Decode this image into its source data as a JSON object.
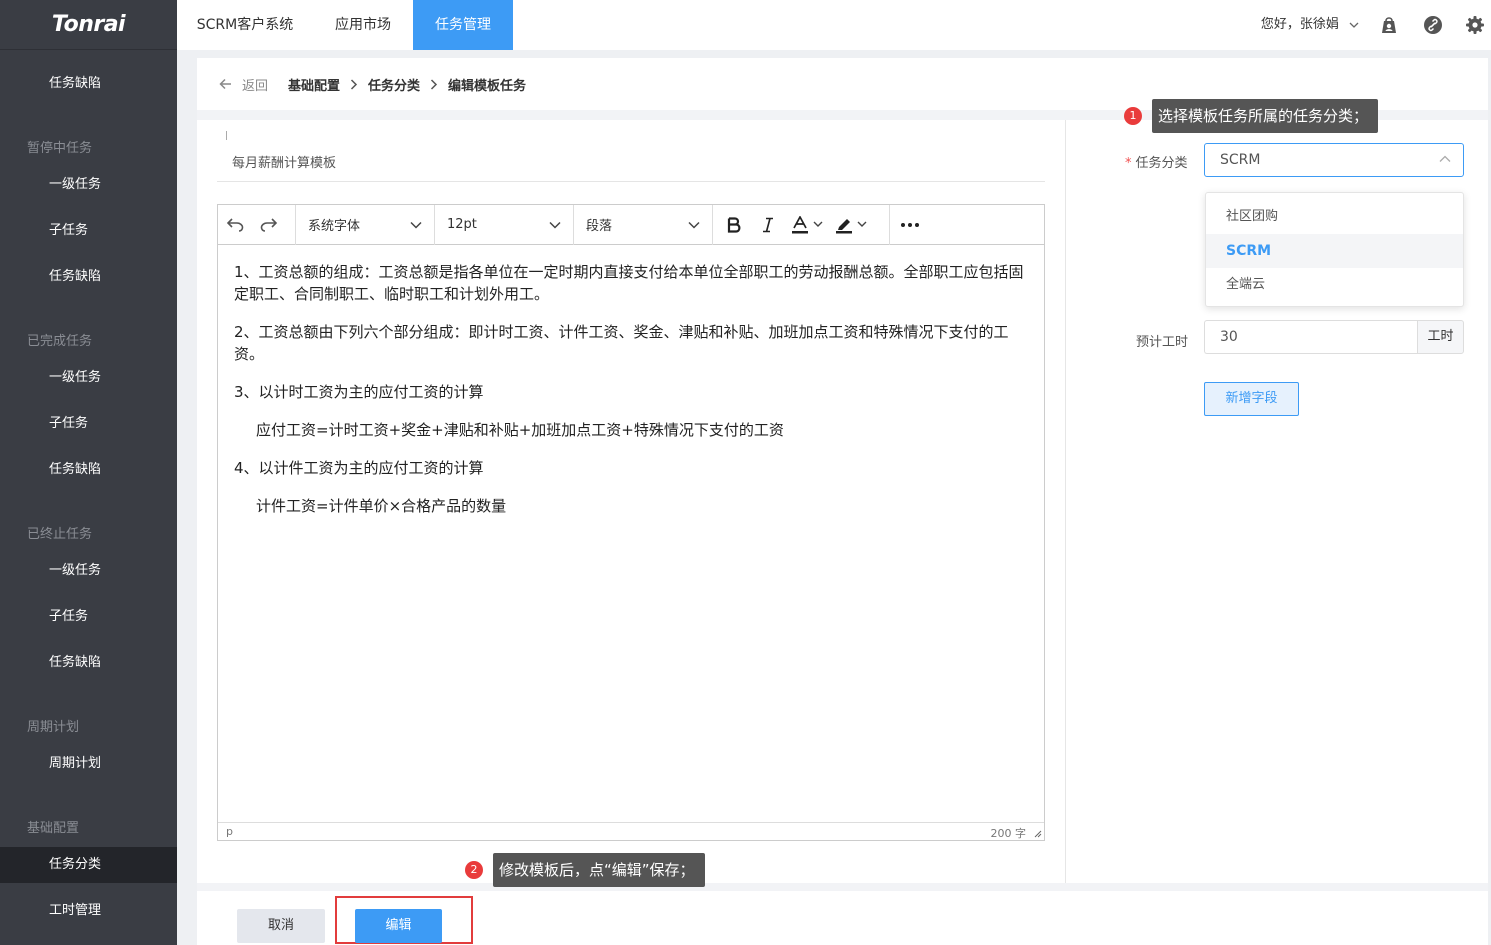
{
  "app": {
    "logo": "Tonrai"
  },
  "sidebar": {
    "groups": [
      {
        "title": "",
        "items": [
          "任务缺陷"
        ]
      },
      {
        "title": "暂停中任务",
        "items": [
          "一级任务",
          "子任务",
          "任务缺陷"
        ]
      },
      {
        "title": "已完成任务",
        "items": [
          "一级任务",
          "子任务",
          "任务缺陷"
        ]
      },
      {
        "title": "已终止任务",
        "items": [
          "一级任务",
          "子任务",
          "任务缺陷"
        ]
      },
      {
        "title": "周期计划",
        "items": [
          "周期计划"
        ]
      },
      {
        "title": "基础配置",
        "items": [
          "任务分类",
          "工时管理"
        ]
      }
    ],
    "active_item": "任务分类"
  },
  "topbar": {
    "nav": [
      "SCRM客户系统",
      "应用市场",
      "任务管理"
    ],
    "active_nav": "任务管理",
    "greeting": "您好，张徐娟",
    "icons": [
      "user-bag-icon",
      "link-icon",
      "gear-icon"
    ]
  },
  "breadcrumb": {
    "back": "返回",
    "items": [
      "基础配置",
      "任务分类",
      "编辑模板任务"
    ]
  },
  "template": {
    "title": "每月薪酬计算模板"
  },
  "editor": {
    "toolbar": {
      "font_family": "系统字体",
      "font_size": "12pt",
      "block": "段落"
    },
    "content": [
      {
        "text": "1、工资总额的组成：工资总额是指各单位在一定时期内直接支付给本单位全部职工的劳动报酬总额。全部职工应包括固定职工、合同制职工、临时职工和计划外用工。",
        "indent": false
      },
      {
        "text": "2、工资总额由下列六个部分组成：即计时工资、计件工资、奖金、津贴和补贴、加班加点工资和特殊情况下支付的工资。",
        "indent": false
      },
      {
        "text": "3、以计时工资为主的应付工资的计算",
        "indent": false
      },
      {
        "text": "应付工资=计时工资+奖金+津贴和补贴+加班加点工资+特殊情况下支付的工资",
        "indent": true
      },
      {
        "text": "4、以计件工资为主的应付工资的计算",
        "indent": false
      },
      {
        "text": "计件工资=计件单价×合格产品的数量",
        "indent": true
      }
    ],
    "status_path": "p",
    "word_count": "200 字"
  },
  "form": {
    "category_label": "任务分类",
    "category_value": "SCRM",
    "category_options": [
      "社区团购",
      "SCRM",
      "全端云"
    ],
    "hours_label": "预计工时",
    "hours_value": "30",
    "hours_unit": "工时",
    "add_field_label": "新增字段"
  },
  "callouts": [
    {
      "num": "1",
      "text": "选择模板任务所属的任务分类；"
    },
    {
      "num": "2",
      "text": "修改模板后，点“编辑”保存；"
    }
  ],
  "footer": {
    "cancel_label": "取消",
    "edit_label": "编辑"
  },
  "colors": {
    "accent": "#3d9bf5",
    "sidebar_bg": "#3a3d44",
    "callout_bg": "#555555",
    "callout_marker": "#e93b3b",
    "highlight": "#e23c3c"
  }
}
